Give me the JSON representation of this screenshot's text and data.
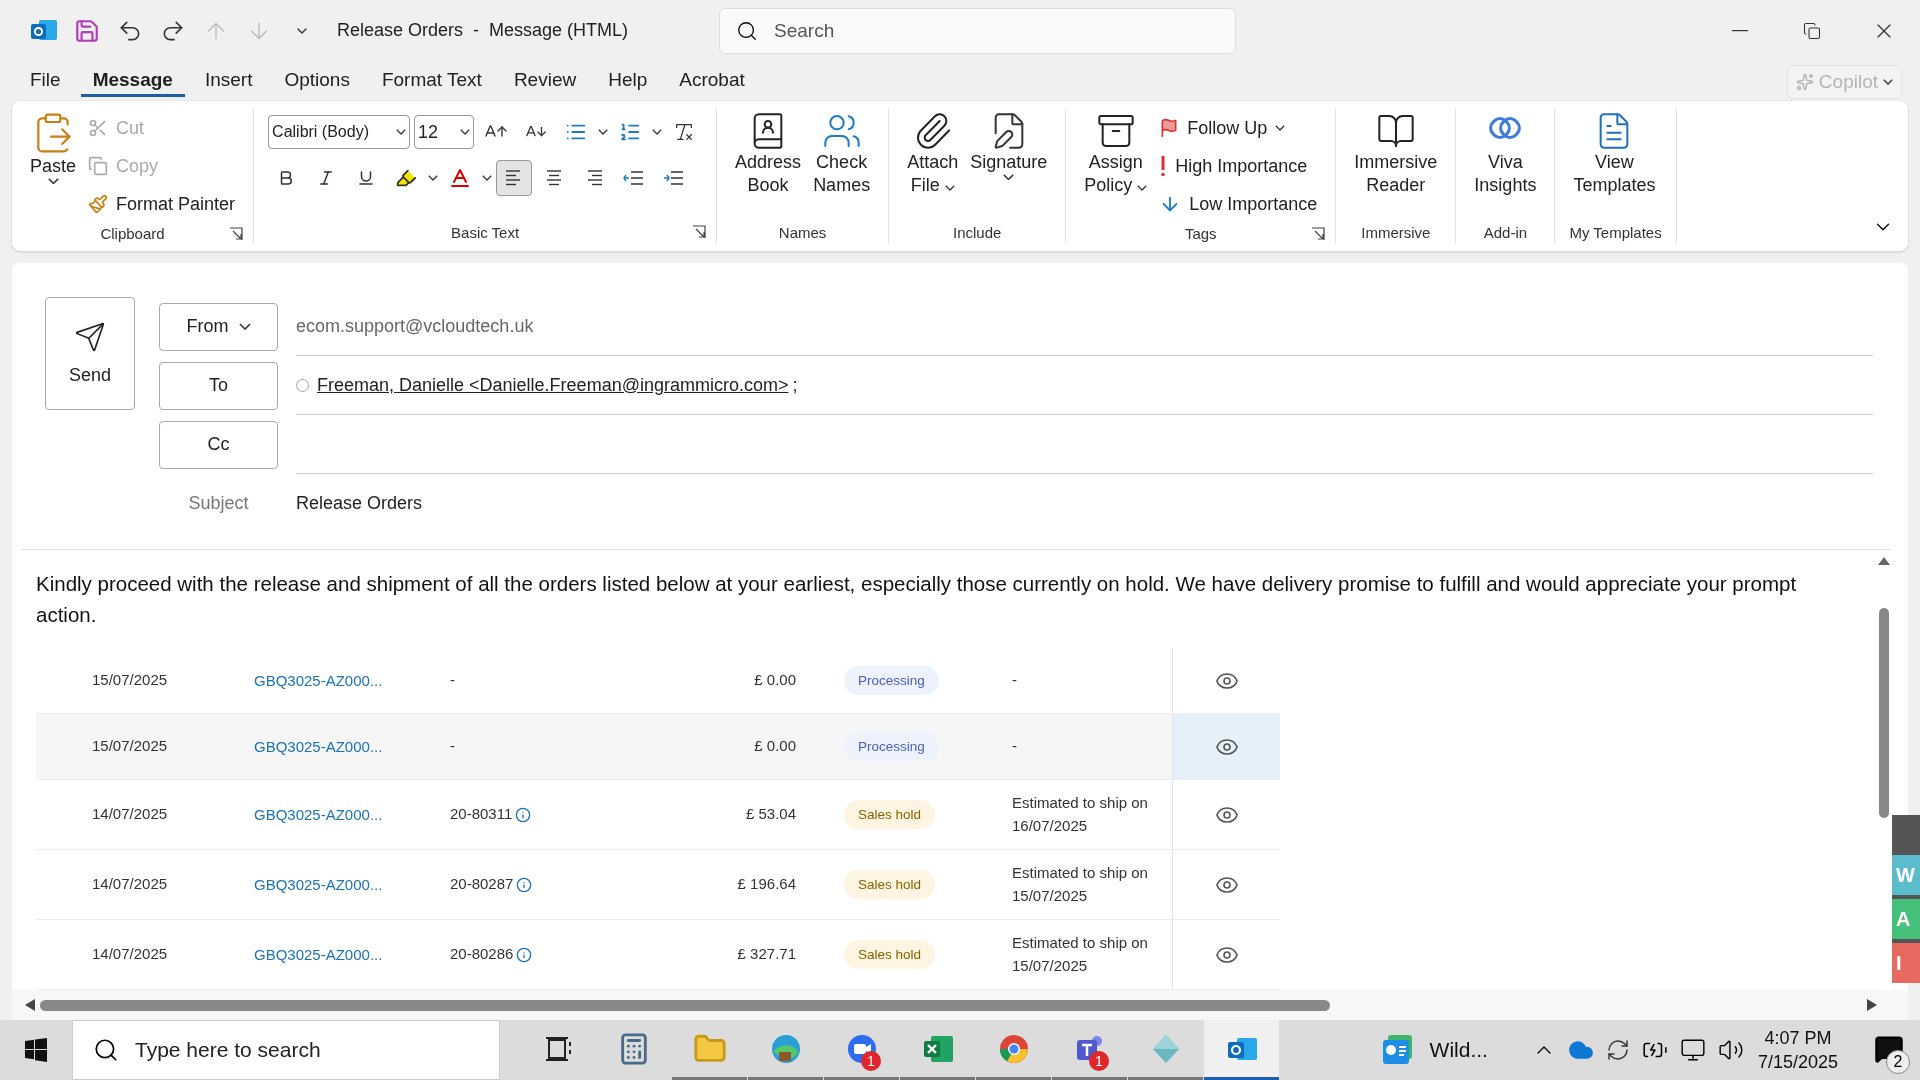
{
  "title_bar": {
    "title": "Release Orders  -  Message (HTML)",
    "search_placeholder": "Search"
  },
  "menu_tabs": [
    {
      "label": "File",
      "selected": false
    },
    {
      "label": "Message",
      "selected": true
    },
    {
      "label": "Insert",
      "selected": false
    },
    {
      "label": "Options",
      "selected": false
    },
    {
      "label": "Format Text",
      "selected": false
    },
    {
      "label": "Review",
      "selected": false
    },
    {
      "label": "Help",
      "selected": false
    },
    {
      "label": "Acrobat",
      "selected": false
    }
  ],
  "copilot": {
    "label": "Copilot",
    "disabled": true
  },
  "ribbon": [
    {
      "kind": "clipboard",
      "label": "Clipboard",
      "launcher": true,
      "paste": "Paste",
      "items": [
        {
          "label": "Cut",
          "disabled": true
        },
        {
          "label": "Copy",
          "disabled": true
        },
        {
          "label": "Format Painter",
          "disabled": false
        }
      ]
    },
    {
      "kind": "basic_text",
      "label": "Basic Text",
      "launcher": true,
      "font": "Calibri (Body)",
      "size": "12",
      "alignments": [
        {
          "selected": true
        },
        {
          "selected": false
        },
        {
          "selected": false
        }
      ]
    },
    {
      "kind": "large",
      "label": "Names",
      "launcher": false,
      "buttons": [
        {
          "lines": [
            "Address",
            "Book"
          ],
          "dropdown": false
        },
        {
          "lines": [
            "Check",
            "Names"
          ],
          "dropdown": false
        }
      ]
    },
    {
      "kind": "large",
      "label": "Include",
      "launcher": false,
      "buttons": [
        {
          "lines": [
            "Attach",
            "File"
          ],
          "dropdown": true
        },
        {
          "lines": [
            "Signature"
          ],
          "dropdown": true
        }
      ]
    },
    {
      "kind": "tags",
      "label": "Tags",
      "launcher": true,
      "buttons": [
        {
          "lines": [
            "Assign",
            "Policy"
          ],
          "dropdown": true
        }
      ],
      "items": [
        {
          "label": "Follow Up",
          "dropdown": true
        },
        {
          "label": "High Importance",
          "dropdown": false
        },
        {
          "label": "Low Importance",
          "dropdown": false
        }
      ]
    },
    {
      "kind": "large",
      "label": "Immersive",
      "launcher": false,
      "buttons": [
        {
          "lines": [
            "Immersive",
            "Reader"
          ],
          "dropdown": false
        }
      ]
    },
    {
      "kind": "large",
      "label": "Add-in",
      "launcher": false,
      "buttons": [
        {
          "lines": [
            "Viva",
            "Insights"
          ],
          "dropdown": false
        }
      ]
    },
    {
      "kind": "large",
      "label": "My Templates",
      "launcher": false,
      "buttons": [
        {
          "lines": [
            "View",
            "Templates"
          ],
          "dropdown": false
        }
      ]
    }
  ],
  "compose": {
    "send": "Send",
    "from": {
      "label": "From",
      "value": "ecom.support@vcloudtech.uk"
    },
    "to": {
      "label": "To",
      "recipients": [
        {
          "name": "Freeman, Danielle <Danielle.Freeman@ingrammicro.com>",
          "separator": ";"
        }
      ]
    },
    "cc": {
      "label": "Cc"
    },
    "subject": {
      "label": "Subject",
      "value": "Release Orders"
    }
  },
  "body": "Kindly proceed with the release and shipment of all the orders listed below at your earliest, especially those currently on hold. We have delivery promise to fulfill and would appreciate your prompt action.",
  "orders": [
    {
      "date": "15/07/2025",
      "order": "GBQ3025-AZ000...",
      "ref": "-",
      "ref_info": false,
      "amount": "£ 0.00",
      "status": {
        "label": "Processing",
        "kind": "processing"
      },
      "ship": "-",
      "selected": false
    },
    {
      "date": "15/07/2025",
      "order": "GBQ3025-AZ000...",
      "ref": "-",
      "ref_info": false,
      "amount": "£ 0.00",
      "status": {
        "label": "Processing",
        "kind": "processing"
      },
      "ship": "-",
      "selected": true
    },
    {
      "date": "14/07/2025",
      "order": "GBQ3025-AZ000...",
      "ref": "20-80311",
      "ref_info": true,
      "amount": "£ 53.04",
      "status": {
        "label": "Sales hold",
        "kind": "hold"
      },
      "ship": "Estimated to ship on 16/07/2025",
      "selected": false
    },
    {
      "date": "14/07/2025",
      "order": "GBQ3025-AZ000...",
      "ref": "20-80287",
      "ref_info": true,
      "amount": "£ 196.64",
      "status": {
        "label": "Sales hold",
        "kind": "hold"
      },
      "ship": "Estimated to ship on 15/07/2025",
      "selected": false
    },
    {
      "date": "14/07/2025",
      "order": "GBQ3025-AZ000...",
      "ref": "20-80286",
      "ref_info": true,
      "amount": "£ 327.71",
      "status": {
        "label": "Sales hold",
        "kind": "hold"
      },
      "ship": "Estimated to ship on 15/07/2025",
      "selected": false
    }
  ],
  "side_tabs": [
    {
      "label": "W",
      "color": "#5bbccc"
    },
    {
      "label": "A",
      "color": "#45c07a"
    },
    {
      "label": "I",
      "color": "#e8695f"
    }
  ],
  "taskbar": {
    "search_placeholder": "Type here to search",
    "apps": [
      {
        "running": false,
        "active": false
      },
      {
        "running": false,
        "active": false
      },
      {
        "running": true,
        "active": false
      },
      {
        "running": true,
        "active": false
      },
      {
        "running": true,
        "active": false,
        "badge": "1"
      },
      {
        "running": true,
        "active": false
      },
      {
        "running": true,
        "active": false
      },
      {
        "running": true,
        "active": false,
        "badge": "1"
      },
      {
        "running": true,
        "active": false
      },
      {
        "running": true,
        "active": true
      }
    ],
    "widget": "Wild...",
    "time": "4:07 PM",
    "date": "7/15/2025",
    "notifications": "2"
  }
}
